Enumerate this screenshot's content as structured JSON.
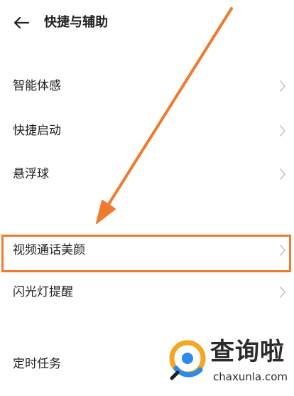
{
  "header": {
    "title": "快捷与辅助",
    "back_icon": "arrow-left-icon"
  },
  "settings": {
    "items": [
      {
        "label": "智能体感"
      },
      {
        "label": "快捷启动"
      },
      {
        "label": "悬浮球"
      },
      {
        "label": "视频通话美颜"
      },
      {
        "label": "闪光灯提醒"
      },
      {
        "label": "定时任务"
      }
    ]
  },
  "annotation": {
    "highlight_color": "#f07a2d",
    "arrow_color": "#f07a2d"
  },
  "watermark": {
    "name_cn": "查询啦",
    "name_en": "chaxunla.com",
    "logo_colors": [
      "#f5a623",
      "#2a8be8"
    ]
  }
}
